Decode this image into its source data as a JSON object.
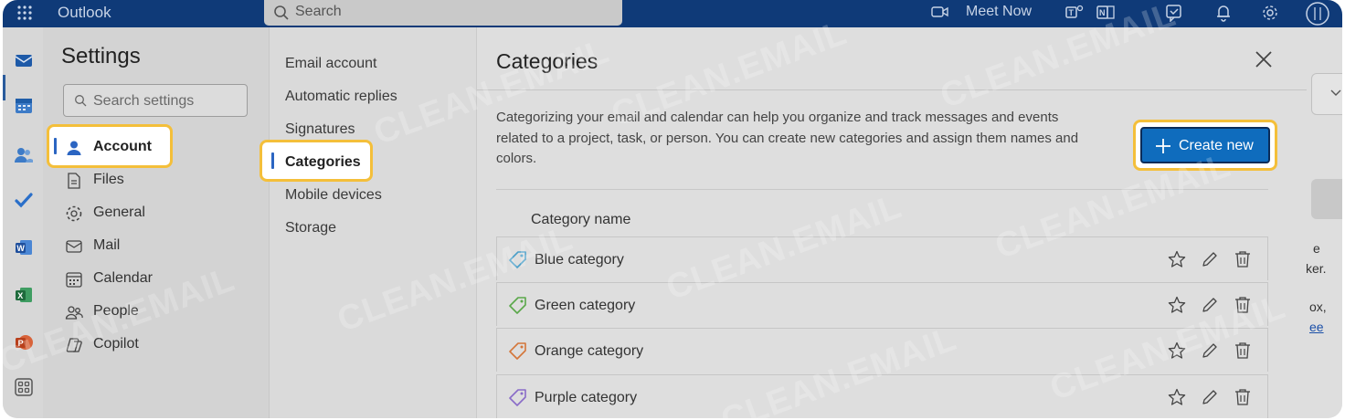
{
  "app": {
    "title": "Outlook"
  },
  "topbar": {
    "search_label": "Search",
    "meet_now": "Meet Now",
    "icons": [
      "waffle-icon",
      "video-icon",
      "teams-icon",
      "onenote-icon",
      "feedback-icon",
      "bell-icon",
      "gear-icon"
    ]
  },
  "rail": {
    "icons": [
      "mail-icon",
      "calendar-icon",
      "people-icon",
      "todo-icon",
      "word-icon",
      "excel-icon",
      "powerpoint-icon",
      "apps-icon"
    ]
  },
  "settings": {
    "title": "Settings",
    "search_placeholder": "Search settings",
    "nav": [
      {
        "label": "Account",
        "icon": "person-icon",
        "selected": true
      },
      {
        "label": "Files",
        "icon": "file-icon"
      },
      {
        "label": "General",
        "icon": "gear-icon"
      },
      {
        "label": "Mail",
        "icon": "mail-icon"
      },
      {
        "label": "Calendar",
        "icon": "calendar-icon"
      },
      {
        "label": "People",
        "icon": "people-icon"
      },
      {
        "label": "Copilot",
        "icon": "copilot-icon"
      }
    ],
    "subnav": [
      {
        "label": "Email account"
      },
      {
        "label": "Automatic replies"
      },
      {
        "label": "Signatures"
      },
      {
        "label": "Categories",
        "selected": true
      },
      {
        "label": "Mobile devices"
      },
      {
        "label": "Storage"
      }
    ]
  },
  "categories": {
    "title": "Categories",
    "description": "Categorizing your email and calendar can help you organize and track messages and events related to a project, task, or person. You can create new categories and assign them names and colors.",
    "create_label": "Create new",
    "column_header": "Category name",
    "items": [
      {
        "name": "Blue category",
        "color": "#4a9fc9"
      },
      {
        "name": "Green category",
        "color": "#5aa84a"
      },
      {
        "name": "Orange category",
        "color": "#d4763a"
      },
      {
        "name": "Purple category",
        "color": "#8a6cc8"
      }
    ]
  },
  "background": {
    "snippets": [
      "e",
      "ker.",
      "ox,",
      "ee"
    ]
  },
  "watermark": "CLEAN.EMAIL",
  "colors": {
    "topbar": "#0f3a78",
    "primary_button": "#0f6cbd",
    "highlight": "#f4bf3a",
    "selection_bar": "#2b65c2"
  }
}
